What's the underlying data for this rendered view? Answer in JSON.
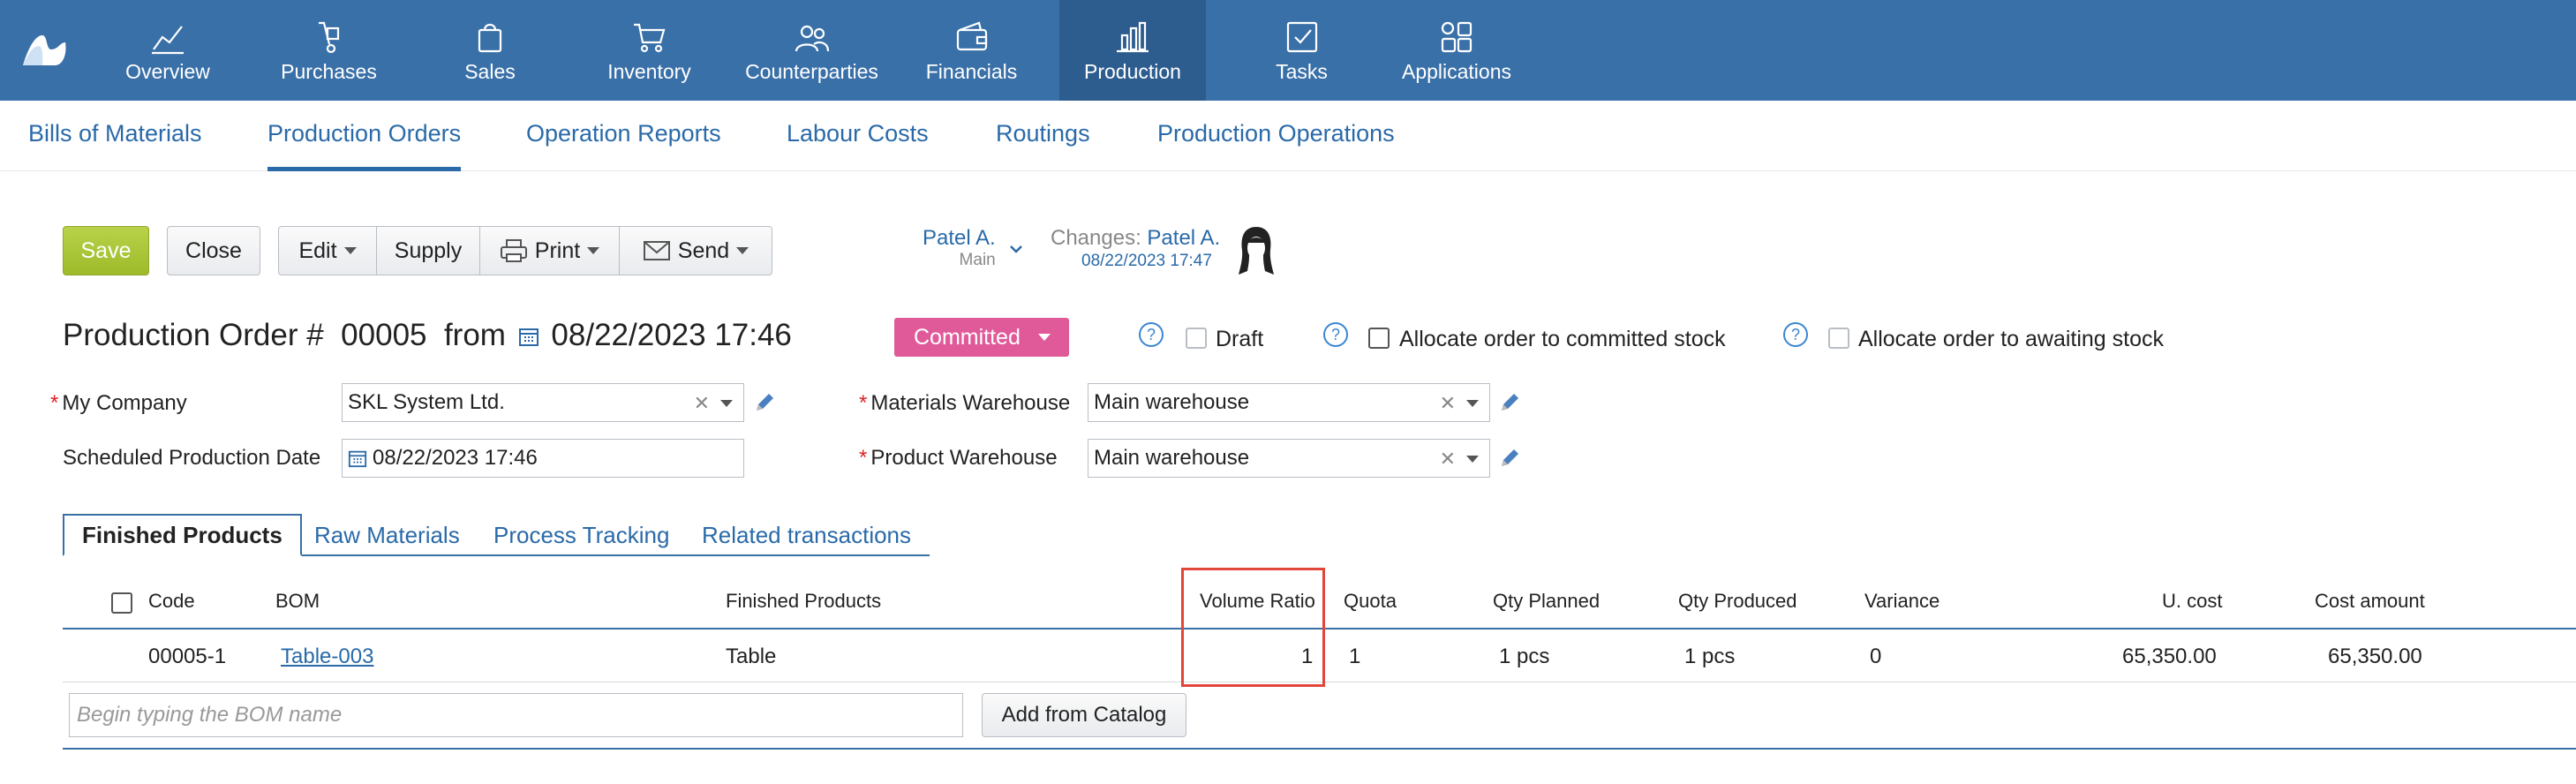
{
  "topnav": {
    "items": [
      {
        "label": "Overview",
        "icon": "chart-line-icon"
      },
      {
        "label": "Purchases",
        "icon": "hand-truck-icon"
      },
      {
        "label": "Sales",
        "icon": "shopping-bag-icon"
      },
      {
        "label": "Inventory",
        "icon": "cart-icon"
      },
      {
        "label": "Counterparties",
        "icon": "people-icon"
      },
      {
        "label": "Financials",
        "icon": "wallet-icon"
      },
      {
        "label": "Production",
        "icon": "bar-chart-icon"
      },
      {
        "label": "Tasks",
        "icon": "checkbox-icon"
      },
      {
        "label": "Applications",
        "icon": "apps-icon"
      }
    ],
    "active": "Production"
  },
  "subnav": {
    "items": [
      "Bills of Materials",
      "Production Orders",
      "Operation Reports",
      "Labour Costs",
      "Routings",
      "Production Operations"
    ],
    "active": "Production Orders"
  },
  "toolbar": {
    "save": "Save",
    "close": "Close",
    "edit": "Edit",
    "supply": "Supply",
    "print": "Print",
    "send": "Send"
  },
  "user": {
    "name": "Patel A.",
    "sub": "Main",
    "changes_label": "Changes:",
    "changes_by": "Patel A.",
    "changes_date": "08/22/2023 17:47"
  },
  "header": {
    "title_prefix": "Production Order #",
    "number": "00005",
    "from": "from",
    "datetime": "08/22/2023 17:46",
    "status": "Committed",
    "draft": "Draft",
    "allocate_committed": "Allocate order to committed stock",
    "allocate_awaiting": "Allocate order to awaiting stock"
  },
  "form": {
    "company_label": "My Company",
    "company_value": "SKL System Ltd.",
    "date_label": "Scheduled Production Date",
    "date_value": "08/22/2023 17:46",
    "materials_wh_label": "Materials Warehouse",
    "materials_wh_value": "Main warehouse",
    "product_wh_label": "Product Warehouse",
    "product_wh_value": "Main warehouse"
  },
  "tabs": [
    "Finished Products",
    "Raw Materials",
    "Process Tracking",
    "Related transactions"
  ],
  "table": {
    "headers": [
      "Code",
      "BOM",
      "Finished Products",
      "Volume Ratio",
      "Quota",
      "Qty Planned",
      "Qty Produced",
      "Variance",
      "U. cost",
      "Cost amount"
    ],
    "rows": [
      {
        "code": "00005-1",
        "bom": "Table-003",
        "product": "Table",
        "volume_ratio": "1",
        "quota": "1",
        "qty_planned": "1 pcs",
        "qty_produced": "1 pcs",
        "variance": "0",
        "unit_cost": "65,350.00",
        "cost_amount": "65,350.00"
      }
    ],
    "bom_placeholder": "Begin typing the BOM name",
    "add_from_catalog": "Add from Catalog"
  },
  "colors": {
    "nav_bg": "#3a70a8",
    "nav_active": "#2d5d8f",
    "save": "#a4c22f",
    "status": "#e05a9a",
    "link": "#2a6aa8",
    "highlight": "#e2453a"
  }
}
